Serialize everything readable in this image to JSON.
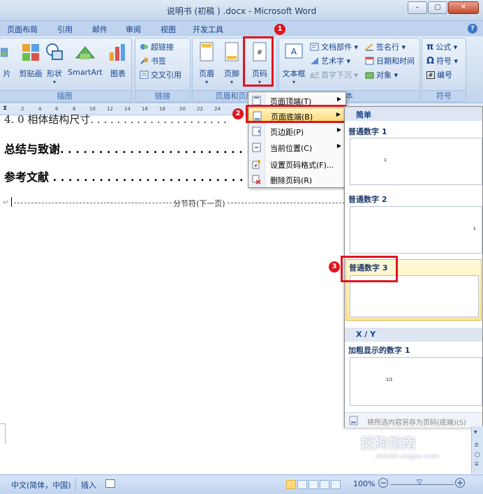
{
  "window": {
    "title": "说明书 (初稿 ) .docx - Microsoft Word",
    "minimize": "–",
    "maximize": "▢",
    "close": "✕"
  },
  "tabs": [
    "页面布局",
    "引用",
    "邮件",
    "审阅",
    "视图",
    "开发工具"
  ],
  "help": "?",
  "ribbon": {
    "illustrations": {
      "label": "插图",
      "buttons": [
        "片",
        "剪贴画",
        "形状",
        "SmartArt",
        "图表"
      ]
    },
    "links": {
      "label": "链接",
      "items": [
        "超链接",
        "书签",
        "交叉引用"
      ]
    },
    "header_footer": {
      "label": "页眉和页脚",
      "buttons": [
        "页眉",
        "页脚",
        "页码"
      ]
    },
    "text": {
      "label": "本",
      "textbox": "文本框",
      "items": [
        "文档部件 ▾",
        "艺术字 ▾",
        "首字下沉 ▾",
        "签名行 ▾",
        "日期和时间",
        "对象 ▾"
      ]
    },
    "symbols": {
      "label": "符号",
      "items": [
        "公式 ▾",
        "符号 ▾",
        "编号"
      ]
    }
  },
  "badges": [
    "1",
    "2",
    "3"
  ],
  "ruler": [
    "2",
    "4",
    "6",
    "8",
    "10",
    "12",
    "14",
    "16",
    "18",
    "20",
    "22",
    "24"
  ],
  "document": {
    "line0": "4. 0 相体结构尺寸. . . . . . . . . . . . . . . . . . . . .",
    "line1": "总结与致谢. . . . . . . . . . . . . . . . . . . . . . . . . .",
    "line2": "参考文献 . . . . . . . . . . . . . . . . . . . . . . . . . . .",
    "section_break": "分节符(下一页)"
  },
  "menu": [
    {
      "label": "页面顶端(T)",
      "arrow": "▶"
    },
    {
      "label": "页面底端(B)",
      "arrow": "▶"
    },
    {
      "label": "页边距(P)",
      "arrow": "▶"
    },
    {
      "label": "当前位置(C)",
      "arrow": "▶"
    },
    {
      "label": "设置页码格式(F)...",
      "arrow": ""
    },
    {
      "label": "删除页码(R)",
      "arrow": ""
    }
  ],
  "gallery": {
    "section1": "简单",
    "items": [
      {
        "name": "普通数字 1",
        "sample": "1"
      },
      {
        "name": "普通数字 2",
        "sample": "1"
      },
      {
        "name": "普通数字 3",
        "sample": ""
      }
    ],
    "section2": "X / Y",
    "item4": {
      "name": "加粗显示的数字 1",
      "sample": "1/1"
    },
    "footer": "将所选内容另存为页码(底端)(S)"
  },
  "status": {
    "language": "中文(简体，中国)",
    "mode": "插入",
    "zoom": "100%"
  },
  "watermark": {
    "text": "搜狗指南",
    "url": "zhinan.sogou.com"
  }
}
